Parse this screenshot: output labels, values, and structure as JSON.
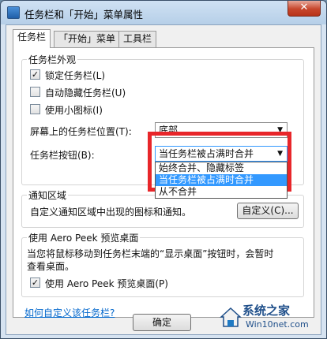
{
  "window": {
    "title": "任务栏和「开始」菜单属性",
    "close_label": "✕"
  },
  "tabs": [
    {
      "label": "任务栏",
      "active": true
    },
    {
      "label": "「开始」菜单",
      "active": false
    },
    {
      "label": "工具栏",
      "active": false
    }
  ],
  "appearance": {
    "title": "任务栏外观",
    "lock_label": "锁定任务栏(L)",
    "lock_checked": true,
    "autohide_label": "自动隐藏任务栏(U)",
    "autohide_checked": false,
    "small_icons_label": "使用小图标(I)",
    "small_icons_checked": false,
    "location_label": "屏幕上的任务栏位置(T):",
    "location_value": "底部",
    "buttons_label": "任务栏按钮(B):",
    "buttons_value": "当任务栏被占满时合并",
    "buttons_options": [
      "始终合并、隐藏标签",
      "当任务栏被占满时合并",
      "从不合并"
    ],
    "buttons_selected_index": 1
  },
  "notification": {
    "title": "通知区域",
    "text": "自定义通知区域中出现的图标和通知。",
    "customize_label": "自定义(C)..."
  },
  "aero_peek": {
    "title": "使用 Aero Peek 预览桌面",
    "description_line1": "当您将鼠标移动到任务栏末端的“显示桌面”按钮时，会暂时",
    "description_line2": "查看桌面。",
    "checkbox_label": "使用 Aero Peek 预览桌面(P)",
    "checkbox_checked": true
  },
  "help_link": "如何自定义该任务栏?",
  "ok_label": "确定",
  "watermark": {
    "brand": "系统之家",
    "url": "Win10net.com"
  },
  "colors": {
    "highlight": "#e8262a",
    "selection": "#3399ff",
    "link": "#0066cc"
  }
}
